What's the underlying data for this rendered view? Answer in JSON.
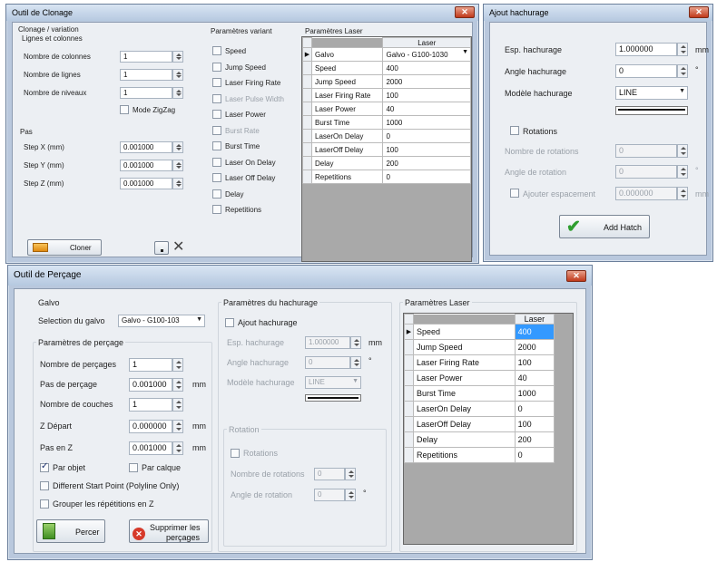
{
  "clonage": {
    "title": "Outil de Clonage",
    "group_clone": "Clonage / variation",
    "group_lines": "Lignes et colonnes",
    "nb_cols_label": "Nombre de colonnes",
    "nb_cols": "1",
    "nb_lines_label": "Nombre de lignes",
    "nb_lines": "1",
    "nb_levels_label": "Nombre de niveaux",
    "nb_levels": "1",
    "zigzag": "Mode ZigZag",
    "pas_label": "Pas",
    "stepx_label": "Step X (mm)",
    "stepx": "0.001000",
    "stepy_label": "Step Y (mm)",
    "stepy": "0.001000",
    "stepz_label": "Step Z (mm)",
    "stepz": "0.001000",
    "params_var": "Paramètres variant",
    "var_items": [
      "Speed",
      "Jump Speed",
      "Laser Firing Rate",
      "Laser Pulse Width",
      "Laser Power",
      "Burst Rate",
      "Burst Time",
      "Laser On Delay",
      "Laser Off Delay",
      "Delay",
      "Repetitions"
    ],
    "params_laser": "Paramètres Laser",
    "grid_header": "Laser",
    "grid_rows": [
      [
        "Galvo",
        "Galvo - G100-1030"
      ],
      [
        "Speed",
        "400"
      ],
      [
        "Jump Speed",
        "2000"
      ],
      [
        "Laser Firing Rate",
        "100"
      ],
      [
        "Laser Power",
        "40"
      ],
      [
        "Burst Time",
        "1000"
      ],
      [
        "LaserOn Delay",
        "0"
      ],
      [
        "LaserOff Delay",
        "100"
      ],
      [
        "Delay",
        "200"
      ],
      [
        "Repetitions",
        "0"
      ]
    ],
    "clone_btn": "Cloner"
  },
  "hatch": {
    "title": "Ajout hachurage",
    "esp_label": "Esp. hachurage",
    "esp": "1.000000",
    "esp_unit": "mm",
    "angle_label": "Angle hachurage",
    "angle": "0",
    "angle_unit": "°",
    "model_label": "Modèle hachurage",
    "model": "LINE",
    "rotations": "Rotations",
    "nb_rot_label": "Nombre de rotations",
    "nb_rot": "0",
    "angle_rot_label": "Angle de rotation",
    "angle_rot": "0",
    "angle_rot_unit": "°",
    "spacing_label": "Ajouter espacement",
    "spacing": "0.000000",
    "spacing_unit": "mm",
    "add_btn": "Add Hatch"
  },
  "percage": {
    "title": "Outil de Perçage",
    "galvo": "Galvo",
    "galvo_sel_label": "Selection du galvo",
    "galvo_sel": "Galvo - G100-103",
    "params_perc": "Paramètres de perçage",
    "nb_perc_label": "Nombre de perçages",
    "nb_perc": "1",
    "pas_perc_label": "Pas de perçage",
    "pas_perc": "0.001000",
    "pas_perc_unit": "mm",
    "nb_couches_label": "Nombre de couches",
    "nb_couches": "1",
    "zdep_label": "Z Départ",
    "zdep": "0.000000",
    "zdep_unit": "mm",
    "pasz_label": "Pas en Z",
    "pasz": "0.001000",
    "pasz_unit": "mm",
    "par_objet": "Par objet",
    "par_calque": "Par calque",
    "diff_start": "Different Start Point (Polyline Only)",
    "grouper": "Grouper les répétitions en Z",
    "percer_btn": "Percer",
    "suppr_btn_1": "Supprimer les",
    "suppr_btn_2": "perçages",
    "params_hach": "Paramètres du hachurage",
    "ajout_hach": "Ajout hachurage",
    "esp_label": "Esp. hachurage",
    "esp": "1.000000",
    "esp_unit": "mm",
    "angle_label": "Angle hachurage",
    "angle": "0",
    "angle_unit": "°",
    "model_label": "Modèle hachurage",
    "model": "LINE",
    "rotation_grp": "Rotation",
    "rotations": "Rotations",
    "nb_rot_label": "Nombre de rotations",
    "nb_rot": "0",
    "angle_rot_label": "Angle de rotation",
    "angle_rot": "0",
    "angle_rot_unit": "°",
    "params_laser": "Paramètres Laser",
    "grid_header": "Laser",
    "grid_rows": [
      [
        "Speed",
        "400"
      ],
      [
        "Jump Speed",
        "2000"
      ],
      [
        "Laser Firing Rate",
        "100"
      ],
      [
        "Laser Power",
        "40"
      ],
      [
        "Burst Time",
        "1000"
      ],
      [
        "LaserOn Delay",
        "0"
      ],
      [
        "LaserOff Delay",
        "100"
      ],
      [
        "Delay",
        "200"
      ],
      [
        "Repetitions",
        "0"
      ]
    ]
  },
  "colors": {
    "title_active": "#c8d6e8",
    "selected_cell": "#3399ff",
    "close": "#c0391b",
    "grid_bg": "#a9a9a9"
  }
}
